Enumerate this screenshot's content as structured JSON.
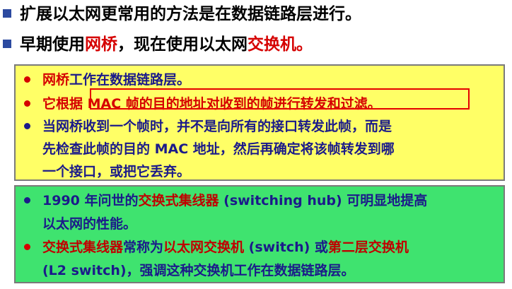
{
  "top": {
    "line1": "扩展以太网更常用的方法是在数据链路层进行。",
    "line2_a": "早期使用",
    "line2_b": "网桥",
    "line2_c": "，现在使用以太网",
    "line2_d": "交换机",
    "line2_e": "。"
  },
  "yellow_box": {
    "item1_a": "网桥",
    "item1_b": "工作在数据链路层。",
    "item2": "它根据 MAC 帧的目的地址对收到的帧进行转发和过滤。",
    "item3_l1": "当网桥收到一个帧时，并不是向所有的接口转发此帧，而是",
    "item3_l2": "先检查此帧的目的 MAC 地址，然后再确定将该帧转发到哪",
    "item3_l3": "一个接口，或把它丢弃。"
  },
  "green_box": {
    "item1_a": "1990 年问世的",
    "item1_b": "交换式集线器",
    "item1_c": " (switching hub) 可明显地提高",
    "item1_d": "以太网的性能。",
    "item2_a": "交换式集线器",
    "item2_b": "常称为",
    "item2_c": "以太网交换机",
    "item2_d": " (switch) 或",
    "item2_e": "第二层交换机",
    "item2_f": "(L2 switch)，强调这种交换机工作在数据链路层。"
  },
  "colors": {
    "accent_red": "#d50000",
    "text_blue": "#1b1a8a",
    "yellow": "#ffff66",
    "green": "#3fe36f"
  }
}
